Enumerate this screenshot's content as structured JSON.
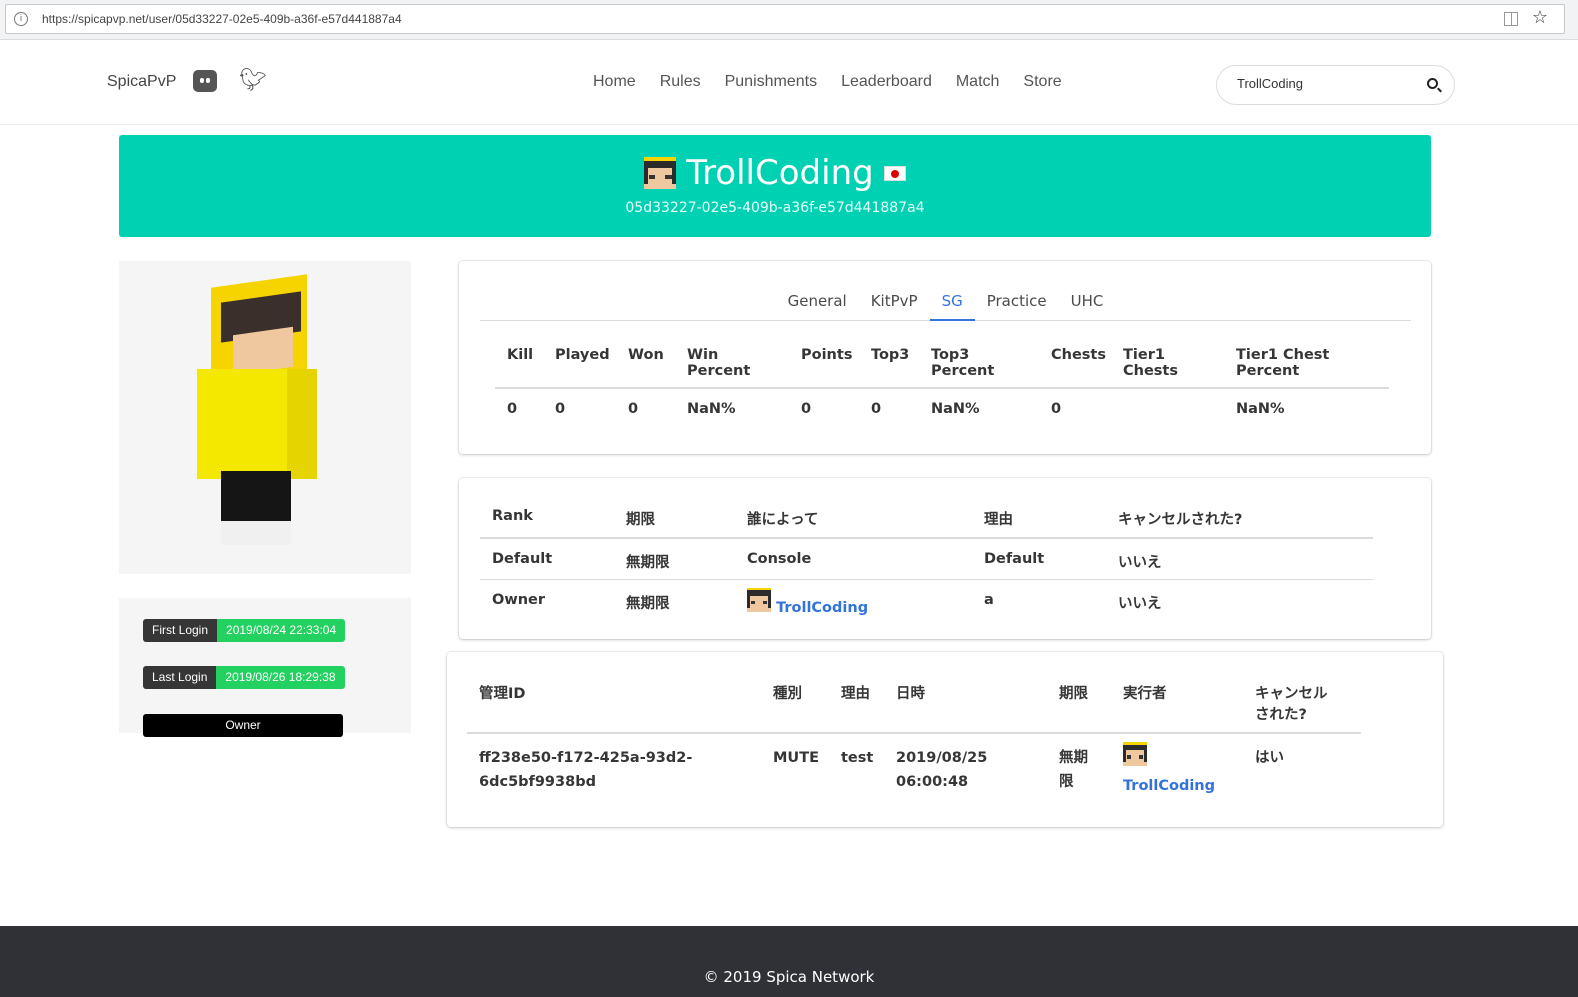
{
  "browser": {
    "url": "https://spicapvp.net/user/05d33227-02e5-409b-a36f-e57d441887a4"
  },
  "navbar": {
    "brand": "SpicaPvP",
    "links": [
      "Home",
      "Rules",
      "Punishments",
      "Leaderboard",
      "Match",
      "Store"
    ],
    "search_value": "TrollCoding"
  },
  "profile": {
    "name": "TrollCoding",
    "uuid": "05d33227-02e5-409b-a36f-e57d441887a4",
    "first_login_label": "First Login",
    "first_login_value": "2019/08/24 22:33:04",
    "last_login_label": "Last Login",
    "last_login_value": "2019/08/26 18:29:38",
    "rank_badge": "Owner"
  },
  "stats": {
    "tabs": [
      "General",
      "KitPvP",
      "SG",
      "Practice",
      "UHC"
    ],
    "active_tab": "SG",
    "headers": [
      [
        "Kill"
      ],
      [
        "Played"
      ],
      [
        "Won"
      ],
      [
        "Win",
        "Percent"
      ],
      [
        "Points"
      ],
      [
        "Top3"
      ],
      [
        "Top3",
        "Percent"
      ],
      [
        "Chests"
      ],
      [
        "Tier1",
        "Chests"
      ],
      [
        "Tier1 Chest",
        "Percent"
      ]
    ],
    "values": [
      "0",
      "0",
      "0",
      "NaN%",
      "0",
      "0",
      "NaN%",
      "0",
      "",
      "NaN%"
    ]
  },
  "ranks": {
    "headers": [
      "Rank",
      "期限",
      "誰によって",
      "理由",
      "キャンセルされた?"
    ],
    "rows": [
      {
        "rank": "Default",
        "expiry": "無期限",
        "by": "Console",
        "reason": "Default",
        "cancelled": "いいえ"
      },
      {
        "rank": "Owner",
        "expiry": "無期限",
        "by": "TrollCoding",
        "reason": "a",
        "cancelled": "いいえ"
      }
    ]
  },
  "punishments": {
    "headers": [
      "管理ID",
      "種別",
      "理由",
      "日時",
      "期限",
      "実行者",
      "キャンセルされた?"
    ],
    "rows": [
      {
        "id": "ff238e50-f172-425a-93d2-6dc5bf9938bd",
        "type": "MUTE",
        "reason": "test",
        "date": "2019/08/25 06:00:48",
        "expiry": "無期限",
        "executor": "TrollCoding",
        "cancelled": "はい"
      }
    ]
  },
  "footer": {
    "text": "© 2019 Spica Network"
  },
  "colors": {
    "hero": "#00d1b2",
    "tab_active": "#3273dc",
    "login_green": "#23d160"
  }
}
